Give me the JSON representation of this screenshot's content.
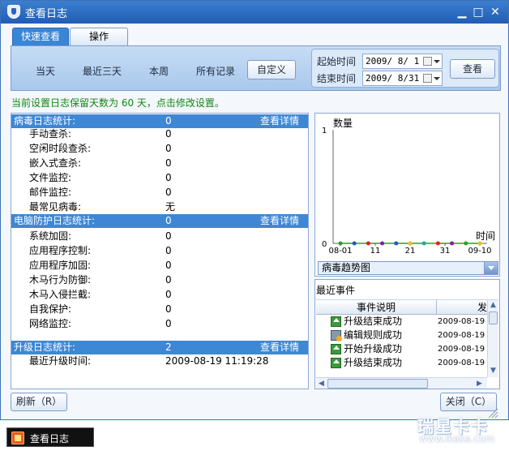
{
  "window": {
    "title": "查看日志",
    "min_glyph": "▁",
    "max_glyph": "□",
    "close_glyph": "✕"
  },
  "tabs": [
    {
      "label": "快速查看",
      "active": true
    },
    {
      "label": "操作",
      "active": false
    }
  ],
  "quick": {
    "today": "当天",
    "last3": "最近三天",
    "week": "本周",
    "all": "所有记录",
    "custom": "自定义",
    "start_label": "起始时间",
    "end_label": "结束时间",
    "start_date": "2009/ 8/ 1",
    "end_date": "2009/ 8/31",
    "query_button": "查看"
  },
  "notice": "当前设置日志保留天数为 60 天，点击修改设置。",
  "stats": {
    "virus": {
      "title": "病毒日志统计:",
      "value": "0",
      "link": "查看详情",
      "rows": [
        {
          "label": "手动查杀:",
          "value": "0"
        },
        {
          "label": "空闲时段查杀:",
          "value": "0"
        },
        {
          "label": "嵌入式查杀:",
          "value": "0"
        },
        {
          "label": "文件监控:",
          "value": "0"
        },
        {
          "label": "邮件监控:",
          "value": "0"
        },
        {
          "label": "最常见病毒:",
          "value": "无"
        }
      ]
    },
    "protect": {
      "title": "电脑防护日志统计:",
      "value": "0",
      "link": "查看详情",
      "rows": [
        {
          "label": "系统加固:",
          "value": "0"
        },
        {
          "label": "应用程序控制:",
          "value": "0"
        },
        {
          "label": "应用程序加固:",
          "value": "0"
        },
        {
          "label": "木马行为防御:",
          "value": "0"
        },
        {
          "label": "木马入侵拦截:",
          "value": "0"
        },
        {
          "label": "自我保护:",
          "value": "0"
        },
        {
          "label": "网络监控:",
          "value": "0"
        }
      ]
    },
    "upgrade": {
      "title": "升级日志统计:",
      "value": "2",
      "link": "查看详情",
      "rows": [
        {
          "label": "最近升级时间:",
          "value": "2009-08-19 11:19:28"
        }
      ]
    }
  },
  "chart_data": {
    "type": "line",
    "title": "",
    "ylabel": "数量",
    "xlabel": "时间",
    "x_ticks": [
      "08-01",
      "11",
      "21",
      "31",
      "09-10"
    ],
    "y_ticks": [
      "0",
      "1"
    ],
    "ylim": [
      0,
      1
    ],
    "series": [
      {
        "values": [
          0,
          0,
          0,
          0,
          0,
          0,
          0,
          0,
          0,
          0,
          0
        ],
        "colors": [
          "#2aa02a",
          "#2255cc",
          "#dd2222",
          "#7722aa",
          "#2255cc",
          "#e8c020",
          "#22aa99",
          "#dd2222",
          "#7722aa",
          "#2aa02a",
          "#e8c020"
        ]
      }
    ],
    "grid": false
  },
  "trend_select": "病毒趋势图",
  "events": {
    "title": "最近事件",
    "col_desc": "事件说明",
    "col_time": "发",
    "rows": [
      {
        "icon": "upgrade-icon",
        "desc": "升级结束成功",
        "time": "2009-08-19"
      },
      {
        "icon": "edit-rule-icon",
        "desc": "编辑规则成功",
        "time": "2009-08-19"
      },
      {
        "icon": "upgrade-icon",
        "desc": "开始升级成功",
        "time": "2009-08-19"
      },
      {
        "icon": "upgrade-icon",
        "desc": "升级结束成功",
        "time": "2009-08-19"
      }
    ]
  },
  "buttons": {
    "refresh": "刷新（R）",
    "close": "关闭（C）"
  },
  "taskbar": {
    "label": "查看日志"
  },
  "watermark": {
    "line1": "瑞星卡卡",
    "line2": "www.ikaka.com"
  },
  "colors": {
    "titlebar": "#2a6ac2",
    "section_header": "#3e87d4",
    "notice": "#118811"
  }
}
